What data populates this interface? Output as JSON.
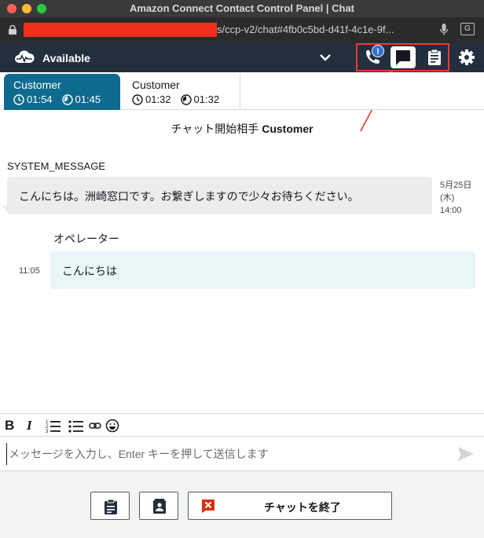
{
  "window": {
    "title": "Amazon Connect Contact Control Panel | Chat",
    "url_visible": "s/ccp-v2/chat#4fb0c5bd-d41f-4c1e-9f...",
    "translate_icon_text": "G"
  },
  "header": {
    "status": "Available",
    "notification_badge": "!"
  },
  "tabs": [
    {
      "name": "Customer",
      "time1": "01:54",
      "time2": "01:45"
    },
    {
      "name": "Customer",
      "time1": "01:32",
      "time2": "01:32"
    }
  ],
  "chat": {
    "start_prefix": "チャット開始相手",
    "start_name": "Customer",
    "messages": [
      {
        "sender": "SYSTEM_MESSAGE",
        "text": "こんにちは。洲崎窓口です。お繋ぎしますので少々お待ちください。",
        "time_line1": "5月25日",
        "time_line2": "(木)",
        "time_line3": "14:00"
      },
      {
        "sender": "オペレーター",
        "text": "こんにちは",
        "time": "11:05"
      }
    ]
  },
  "toolbar": {
    "bold": "B",
    "italic": "I"
  },
  "compose": {
    "value": "",
    "placeholder": "メッセージを入力し、Enter キーを押して送信します"
  },
  "footer": {
    "end_chat_label": "チャットを終了"
  },
  "colors": {
    "header_bg": "#232f3e",
    "active_tab": "#0e6a8e",
    "annotation_red": "#ee3a2a",
    "operator_bubble": "#e8f6f8",
    "system_bubble": "#ececec"
  }
}
